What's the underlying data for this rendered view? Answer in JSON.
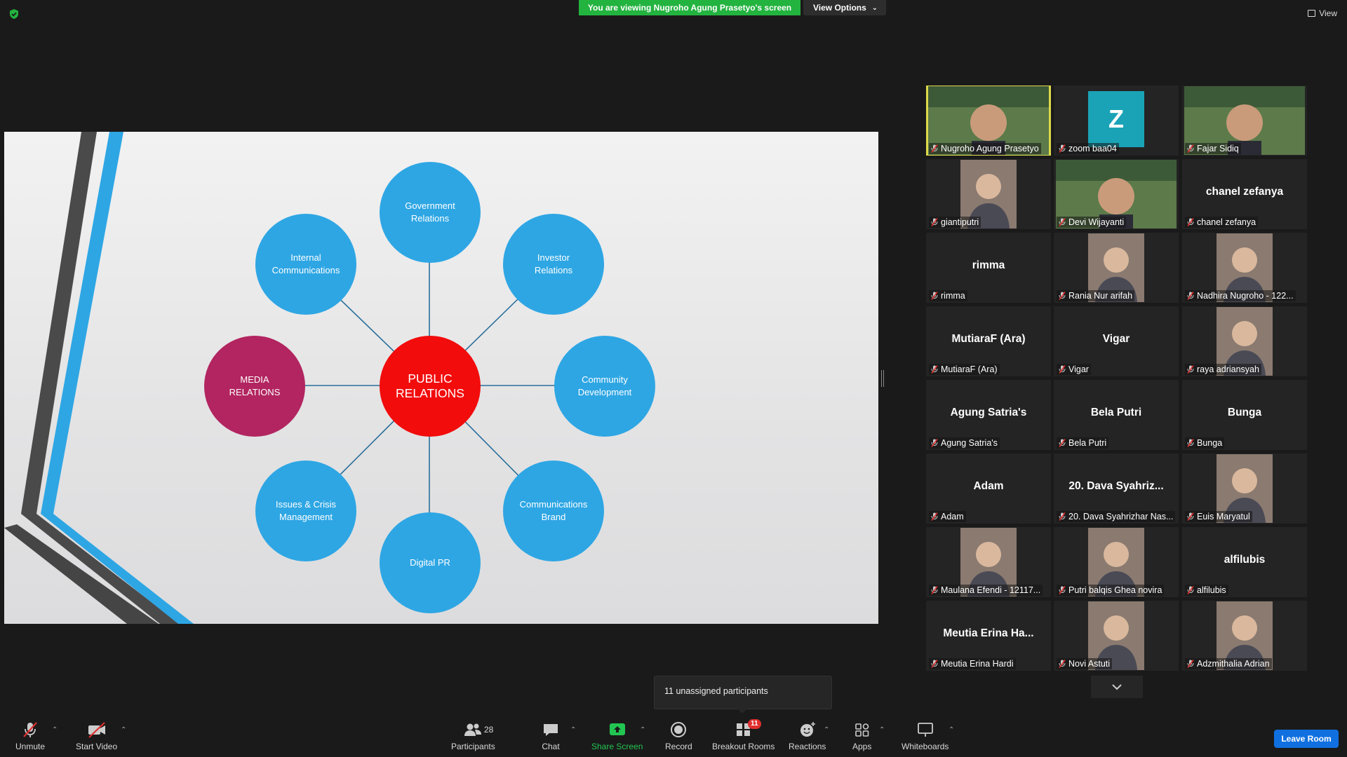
{
  "banner": {
    "viewing_text": "You are viewing Nugroho Agung Prasetyo's screen",
    "view_options_label": "View Options",
    "view_label": "View"
  },
  "slide": {
    "center_label": "PUBLIC\nRELATIONS",
    "nodes": [
      {
        "label": "Government\nRelations"
      },
      {
        "label": "Investor\nRelations"
      },
      {
        "label": "Community\nDevelopment"
      },
      {
        "label": "Communications\nBrand"
      },
      {
        "label": "Digital  PR"
      },
      {
        "label": "Issues & Crisis\nManagement"
      },
      {
        "label": "MEDIA\nRELATIONS"
      },
      {
        "label": "Internal\nCommunications"
      }
    ],
    "colors": {
      "node": "#2ea6e4",
      "media_node": "#b22560",
      "center": "#f20c0c",
      "connector": "#2a6f9a"
    }
  },
  "gallery": {
    "tiles": [
      {
        "name": "Nugroho Agung Prasetyo",
        "big": "",
        "photo": "video"
      },
      {
        "name": "zoom baa04",
        "big": "",
        "photo": "z"
      },
      {
        "name": "Fajar Sidiq",
        "big": "",
        "photo": "video"
      },
      {
        "name": "giantiputri",
        "big": "",
        "photo": "portrait"
      },
      {
        "name": "Devi Wijayanti",
        "big": "",
        "photo": "video"
      },
      {
        "name": "chanel zefanya",
        "big": "chanel zefanya",
        "photo": ""
      },
      {
        "name": "rimma",
        "big": "rimma",
        "photo": ""
      },
      {
        "name": "Rania Nur arifah",
        "big": "",
        "photo": "portrait"
      },
      {
        "name": "Nadhira Nugroho - 122...",
        "big": "",
        "photo": "portrait"
      },
      {
        "name": "MutiaraF (Ara)",
        "big": "MutiaraF (Ara)",
        "photo": ""
      },
      {
        "name": "Vigar",
        "big": "Vigar",
        "photo": ""
      },
      {
        "name": "raya adriansyah",
        "big": "",
        "photo": "portrait"
      },
      {
        "name": "Agung Satria's",
        "big": "Agung Satria's",
        "photo": ""
      },
      {
        "name": "Bela Putri",
        "big": "Bela Putri",
        "photo": ""
      },
      {
        "name": "Bunga",
        "big": "Bunga",
        "photo": ""
      },
      {
        "name": "Adam",
        "big": "Adam",
        "photo": ""
      },
      {
        "name": "20. Dava Syahrizhar Nas...",
        "big": "20. Dava Syahriz...",
        "photo": ""
      },
      {
        "name": "Euis Maryatul",
        "big": "",
        "photo": "portrait"
      },
      {
        "name": "Maulana Efendi - 12117...",
        "big": "",
        "photo": "portrait"
      },
      {
        "name": "Putri balqis Ghea novira",
        "big": "",
        "photo": "portrait"
      },
      {
        "name": "alfilubis",
        "big": "alfilubis",
        "photo": ""
      },
      {
        "name": "Meutia Erina Hardi",
        "big": "Meutia Erina Ha...",
        "photo": ""
      },
      {
        "name": "Novi Astuti",
        "big": "",
        "photo": "portrait"
      },
      {
        "name": "Adzmithalia Adrian",
        "big": "",
        "photo": "portrait"
      }
    ],
    "z_letter": "Z"
  },
  "tooltip": {
    "unassigned": "11 unassigned participants"
  },
  "toolbar": {
    "unmute": "Unmute",
    "start_video": "Start Video",
    "participants": "Participants",
    "participants_count": "28",
    "chat": "Chat",
    "share_screen": "Share Screen",
    "record": "Record",
    "breakout_rooms": "Breakout Rooms",
    "breakout_badge": "11",
    "reactions": "Reactions",
    "apps": "Apps",
    "whiteboards": "Whiteboards",
    "leave_room": "Leave Room"
  }
}
